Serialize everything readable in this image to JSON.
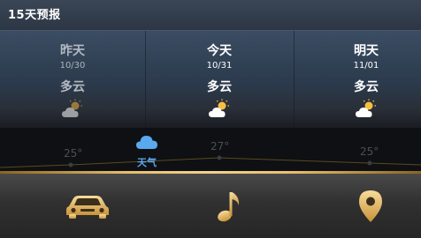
{
  "header": {
    "title": "15天预报"
  },
  "forecast": [
    {
      "day": "昨天",
      "date": "10/30",
      "condition": "多云",
      "icon": "partly-cloudy-icon"
    },
    {
      "day": "今天",
      "date": "10/31",
      "condition": "多云",
      "icon": "partly-cloudy-icon"
    },
    {
      "day": "明天",
      "date": "11/01",
      "condition": "多云",
      "icon": "partly-cloudy-icon"
    }
  ],
  "temperatures": [
    "25°",
    "27°",
    "25°"
  ],
  "weather_tab": {
    "label": "天气",
    "icon": "cloud-icon",
    "color": "#5aa8ee"
  },
  "dock": [
    {
      "name": "car",
      "icon": "car-icon"
    },
    {
      "name": "music",
      "icon": "music-note-icon"
    },
    {
      "name": "navigation",
      "icon": "location-pin-icon"
    }
  ],
  "colors": {
    "accent_gold": "#e8be6c",
    "weather_blue": "#5aa8ee"
  }
}
